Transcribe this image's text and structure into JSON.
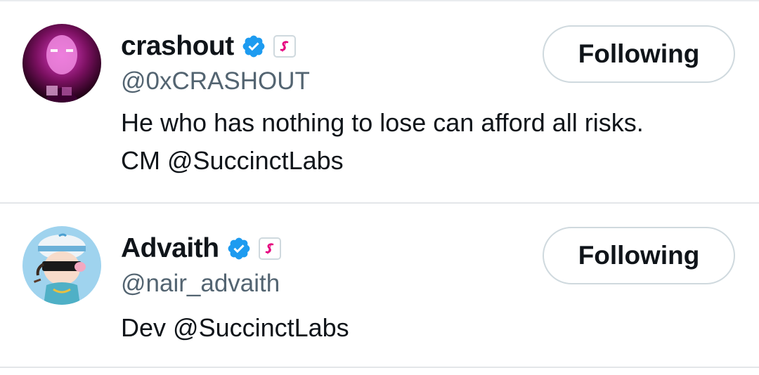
{
  "users": [
    {
      "name": "crashout",
      "handle": "@0xCRASHOUT",
      "bio_lines": [
        "He who has nothing to lose can afford all risks.",
        "CM @SuccinctLabs"
      ],
      "follow_label": "Following",
      "avatar_icon": "avatar-pink-portrait",
      "verified_icon": "verified-badge-icon",
      "affiliate_icon": "succinct-affiliate-icon"
    },
    {
      "name": "Advaith",
      "handle": "@nair_advaith",
      "bio_lines": [
        "Dev @SuccinctLabs"
      ],
      "follow_label": "Following",
      "avatar_icon": "avatar-cartoon-character",
      "verified_icon": "verified-badge-icon",
      "affiliate_icon": "succinct-affiliate-icon"
    }
  ],
  "colors": {
    "verified": "#1d9bf0",
    "affiliate": "#e5007e",
    "secondary_text": "#536471",
    "border": "#cfd9de"
  }
}
